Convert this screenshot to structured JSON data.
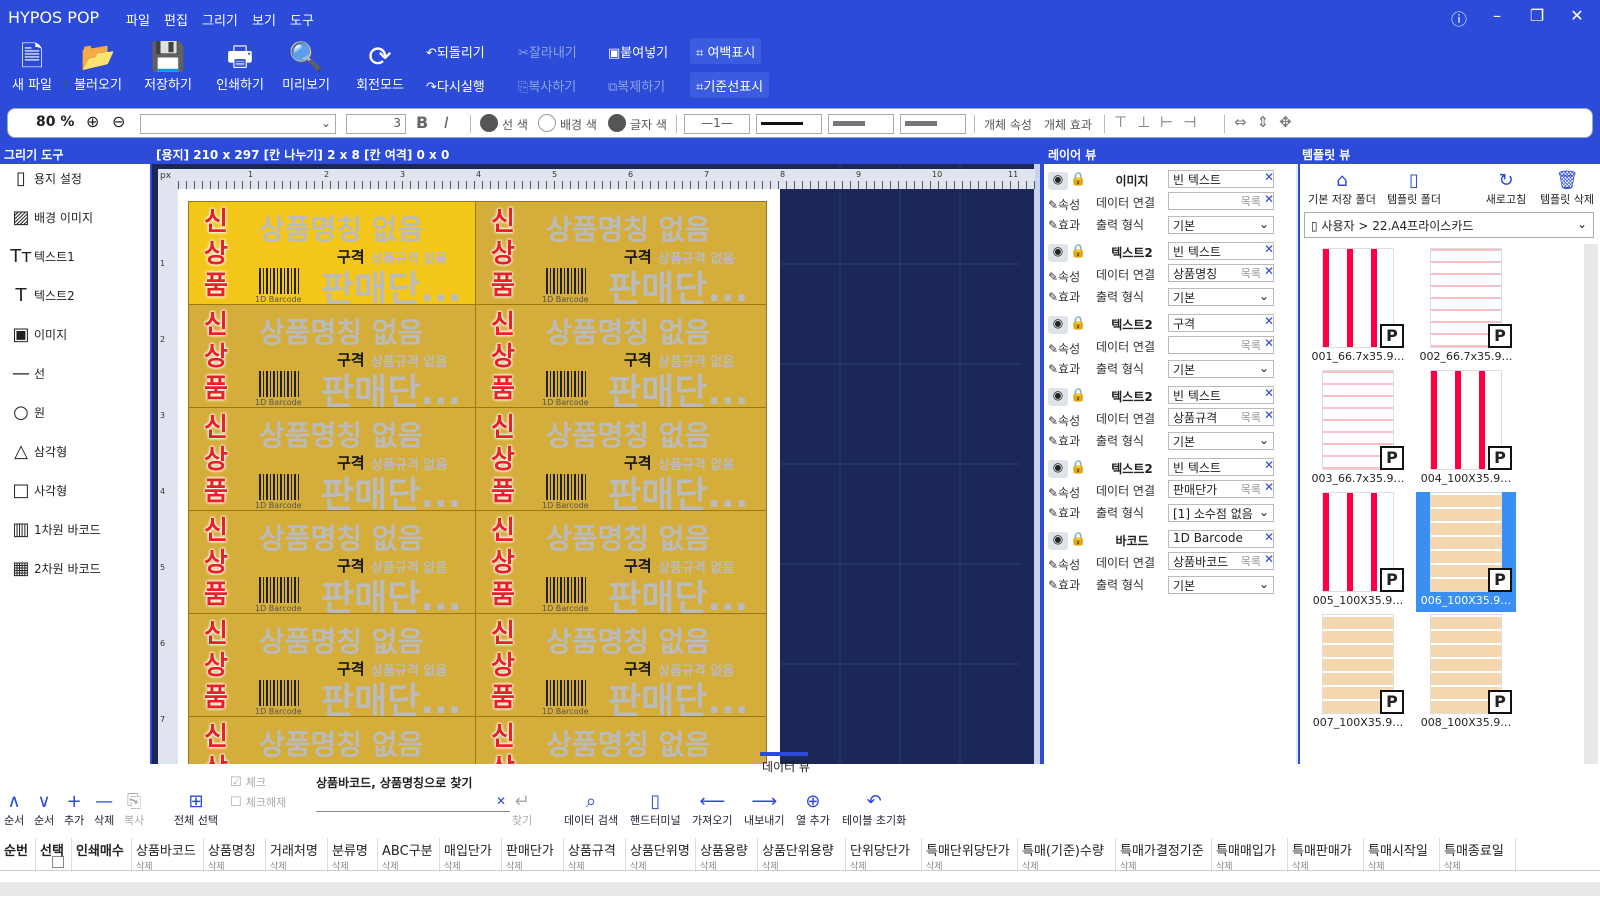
{
  "app": {
    "title": "HYPOS POP",
    "menu": [
      "파일",
      "편집",
      "그리기",
      "보기",
      "도구"
    ]
  },
  "ribbon": {
    "big": [
      {
        "label": "새 파일",
        "icon": "new-file-icon"
      },
      {
        "label": "불러오기",
        "icon": "folder-icon"
      },
      {
        "label": "저장하기",
        "icon": "save-icon"
      },
      {
        "label": "인쇄하기",
        "icon": "printer-icon"
      },
      {
        "label": "미리보기",
        "icon": "preview-icon"
      },
      {
        "label": "회전모드",
        "icon": "rotate-icon"
      }
    ],
    "undo": "되돌리기",
    "redo": "다시실행",
    "cut": "잘라내기",
    "copy": "복사하기",
    "paste": "붙여넣기",
    "duplicate": "복제하기",
    "margin": "여백표시",
    "guideline": "기준선표시"
  },
  "toolbar": {
    "zoom": "80 %",
    "font_size": "3",
    "line_color": "선 색",
    "bg_color": "배경 색",
    "text_color": "글자 색",
    "line_width": "1",
    "obj_prop": "개체 속성",
    "obj_effect": "개체 효과"
  },
  "panels": {
    "draw_tools": "그리기 도구",
    "canvas_info": "[용지] 210 x 297  [칸 나누기] 2 x 8  [칸 여격] 0 x 0",
    "layer_view": "레이어 뷰",
    "template_view": "템플릿 뷰",
    "data_view": "데이터 뷰"
  },
  "draw_tools": [
    {
      "label": "용지 설정",
      "icon": "paper-icon"
    },
    {
      "label": "배경 이미지",
      "icon": "bg-image-icon"
    },
    {
      "label": "텍스트1",
      "icon": "text1-icon"
    },
    {
      "label": "텍스트2",
      "icon": "text2-icon"
    },
    {
      "label": "이미지",
      "icon": "image-icon"
    },
    {
      "label": "선",
      "icon": "line-icon"
    },
    {
      "label": "원",
      "icon": "circle-icon"
    },
    {
      "label": "삼각형",
      "icon": "triangle-icon"
    },
    {
      "label": "사각형",
      "icon": "rectangle-icon"
    },
    {
      "label": "1차원 바코드",
      "icon": "barcode-icon"
    },
    {
      "label": "2차원 바코드",
      "icon": "qrcode-icon"
    }
  ],
  "ruler": {
    "unit": "px",
    "h_ticks": [
      "1",
      "2",
      "3",
      "4",
      "5",
      "6",
      "7",
      "8",
      "9",
      "10",
      "11"
    ],
    "v_ticks": [
      "1",
      "2",
      "3",
      "4",
      "5",
      "6",
      "7"
    ]
  },
  "label": {
    "badge": [
      "신",
      "상",
      "품"
    ],
    "name": "상품명칭 없음",
    "spec_label": "구격",
    "spec_value": "상품규격 없음",
    "price": "판매단...",
    "barcode": "1D Barcode"
  },
  "layers": [
    {
      "name": "이미지",
      "field": "빈 텍스트",
      "link": "",
      "fmt": "기본"
    },
    {
      "name": "텍스트2",
      "field": "빈 텍스트",
      "link": "상품명칭",
      "fmt": "기본"
    },
    {
      "name": "텍스트2",
      "field": "구격",
      "link": "",
      "fmt": "기본"
    },
    {
      "name": "텍스트2",
      "field": "빈 텍스트",
      "link": "상품규격",
      "fmt": "기본"
    },
    {
      "name": "텍스트2",
      "field": "빈 텍스트",
      "link": "판매단가",
      "fmt": "[1] 소수점 없음"
    },
    {
      "name": "바코드",
      "field": "1D Barcode",
      "link": "상품바코드",
      "fmt": "기본"
    }
  ],
  "layer_labels": {
    "prop": "속성",
    "effect": "효과",
    "data_link": "데이터 연결",
    "output": "출력 형식",
    "list": "목록"
  },
  "template": {
    "btns": [
      "기본 저장 폴더",
      "템플릿 폴더",
      "새로고침",
      "템플릿 삭제"
    ],
    "path": "사용자 > 22.A4프라이스카드",
    "items": [
      "001_66.7x35.9…",
      "002_66.7x35.9…",
      "003_66.7x35.9…",
      "004_100X35.9…",
      "005_100X35.9…",
      "006_100X35.9…",
      "007_100X35.9…",
      "008_100X35.9…"
    ]
  },
  "dataview": {
    "btns": [
      "순서",
      "순서",
      "추가",
      "삭제",
      "복사",
      "전체 선택",
      "체크",
      "체크해제",
      "찾기",
      "데이터 검색",
      "핸드터미널",
      "가져오기",
      "내보내기",
      "열 추가",
      "테이블 초기화"
    ],
    "search_placeholder": "상품바코드, 상품명칭으로 찾기",
    "columns": [
      "순번",
      "선택",
      "인쇄매수",
      "상품바코드",
      "상품명칭",
      "거래처명",
      "분류명",
      "ABC구분",
      "매입단가",
      "판매단가",
      "상품규격",
      "상품단위명",
      "상품용량",
      "상품단위용량",
      "단위당단가",
      "특매단위당단가",
      "특매(기준)수량",
      "특매가결정기준",
      "특매매입가",
      "특매판매가",
      "특매시작일",
      "특매종료일"
    ],
    "del": "삭제"
  }
}
